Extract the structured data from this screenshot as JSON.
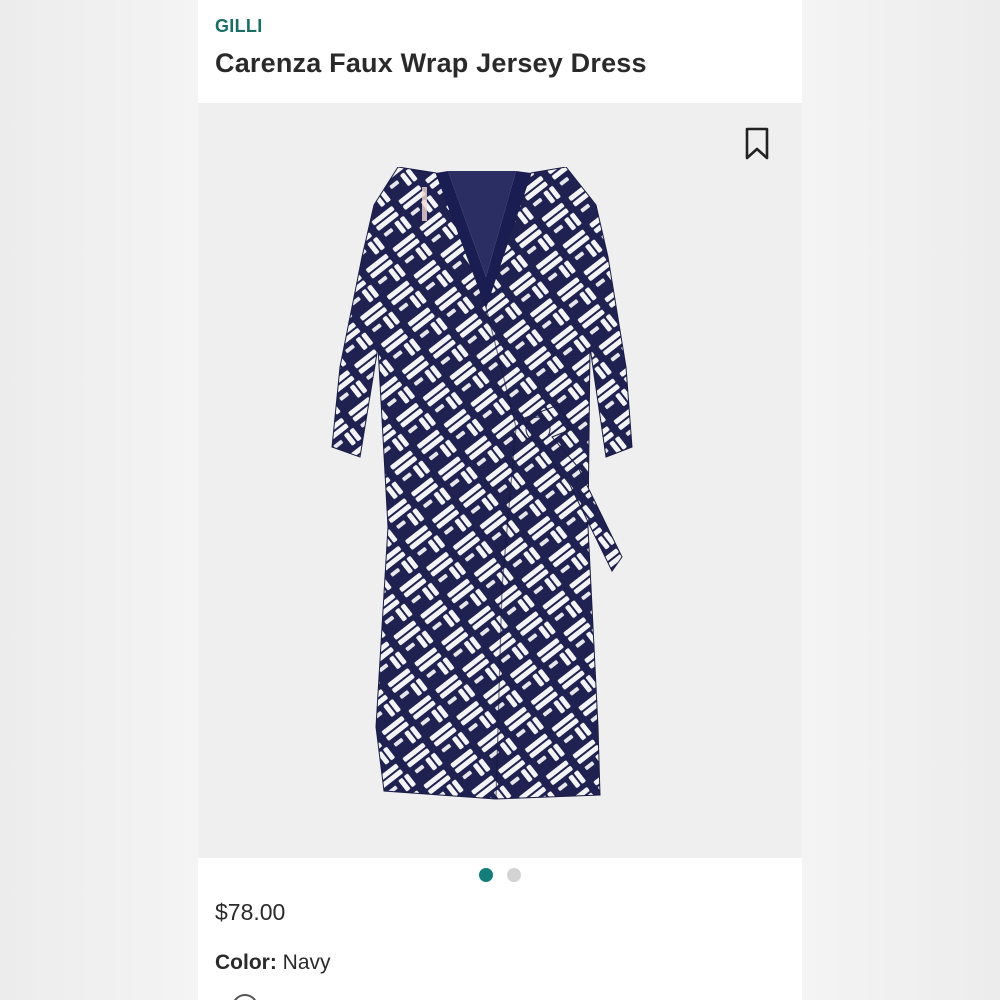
{
  "product": {
    "brand": "GILLI",
    "title": "Carenza Faux Wrap Jersey Dress",
    "price": "$78.00",
    "color_label": "Color:",
    "color_value": "Navy"
  },
  "gallery": {
    "image_count": 2,
    "active_index": 0,
    "image_subject": "dress-photo"
  },
  "icons": {
    "bookmark": "bookmark-icon"
  },
  "colors": {
    "brand_teal": "#1b6e66",
    "active_dot": "#137d7a",
    "inactive_dot": "#d3d3d3",
    "navy": "#1f2250",
    "panel_bg": "#efeff0"
  }
}
